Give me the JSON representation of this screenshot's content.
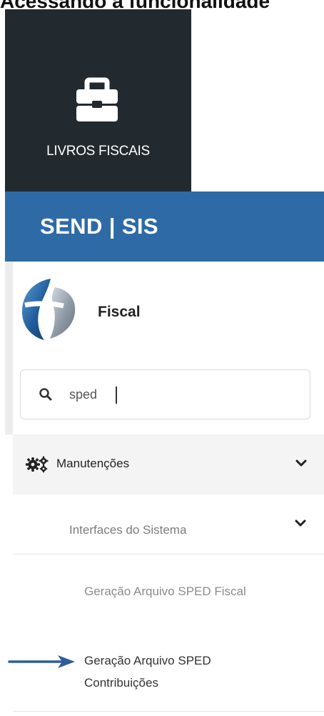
{
  "page": {
    "heading": "Acessando a funcionalidade"
  },
  "module": {
    "label": "LIVROS FISCAIS",
    "icon": "briefcase-icon",
    "background": "#232a2f"
  },
  "brand": {
    "title": "SEND | SIS",
    "background": "#2e6aa6"
  },
  "sidebar": {
    "module_title": "Fiscal",
    "logo": "fiscal-logo",
    "search": {
      "value": "sped",
      "icon": "search-icon"
    },
    "menu": {
      "main_item": {
        "label": "Manutenções",
        "icon": "gears-icon",
        "expanded": true
      },
      "submenu_item": {
        "label": "Interfaces do Sistema",
        "expanded": true
      },
      "links": [
        {
          "label": "Geração Arquivo SPED Fiscal"
        },
        {
          "label_line1": "Geração Arquivo SPED",
          "label_line2": "Contribuições",
          "highlighted": true
        }
      ]
    }
  },
  "annotation": {
    "pointer": "right-arrow",
    "color": "#2d5d9b"
  }
}
